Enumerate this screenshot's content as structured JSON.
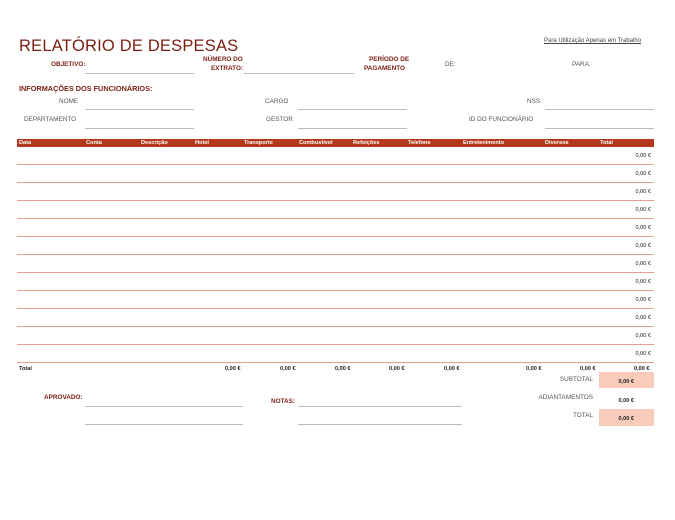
{
  "header": {
    "title": "RELATÓRIO DE DESPESAS",
    "work_note": "Para Utilização Apenas em Trabalho"
  },
  "fields": {
    "objetivo": "OBJETIVO:",
    "numero_do": "NÚMERO DO",
    "extrato": "EXTRATO:",
    "periodo_de": "PERÍODO DE",
    "pagamento": "PAGAMENTO",
    "de": "DE:",
    "para": "PARA:"
  },
  "employee": {
    "section_title": "INFORMAÇÕES DOS FUNCIONÁRIOS:",
    "nome": "NOME",
    "cargo": "CARGO",
    "nss": "NSS",
    "departamento": "DEPARTAMENTO",
    "gestor": "GESTOR",
    "id_funcionario": "ID DO FUNCIONÁRIO"
  },
  "table": {
    "headers": [
      "Data",
      "Conta",
      "Descrição",
      "Hotel",
      "Transporte",
      "Combustível",
      "Refeições",
      "Telefone",
      "Entretenimento",
      "Diversos",
      "Total"
    ],
    "rows": [
      {
        "total": "0,00 €"
      },
      {
        "total": "0,00 €"
      },
      {
        "total": "0,00 €"
      },
      {
        "total": "0,00 €"
      },
      {
        "total": "0,00 €"
      },
      {
        "total": "0,00 €"
      },
      {
        "total": "0,00 €"
      },
      {
        "total": "0,00 €"
      },
      {
        "total": "0,00 €"
      },
      {
        "total": "0,00 €"
      },
      {
        "total": "0,00 €"
      },
      {
        "total": "0,00 €"
      }
    ],
    "totals": {
      "label": "Total",
      "hotel": "0,00 €",
      "transporte": "0,00 €",
      "combustivel": "0,00 €",
      "refeicoes": "0,00 €",
      "telefone": "0,00 €",
      "entretenimento": "0,00 €",
      "diversos": "0,00 €",
      "total": "0,00 €"
    }
  },
  "summary": {
    "subtotal_label": "SUBTOTAL",
    "subtotal_value": "0,00 €",
    "adiantamentos_label": "ADIANTAMENTOS",
    "adiantamentos_value": "0,00 €",
    "total_label": "TOTAL",
    "total_value": "0,00 €"
  },
  "signoff": {
    "aprovado": "APROVADO:",
    "notas": "NOTAS:"
  },
  "colors": {
    "accent": "#b5371c",
    "title": "#7b1f12",
    "row_line": "#e8a08c",
    "summary_fill": "#f8cbbb"
  }
}
